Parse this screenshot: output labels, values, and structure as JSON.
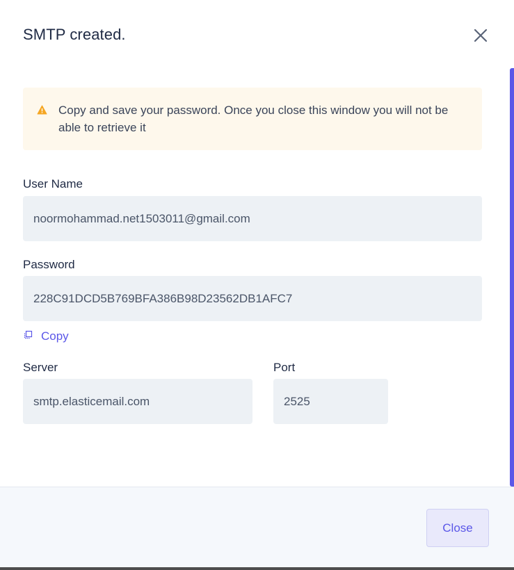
{
  "modal": {
    "title": "SMTP created."
  },
  "warning": {
    "message": "Copy and save your password. Once you close this window you will not be able to retrieve it"
  },
  "fields": {
    "username": {
      "label": "User Name",
      "value": "noormohammad.net1503011@gmail.com"
    },
    "password": {
      "label": "Password",
      "value": "228C91DCD5B769BFA386B98D23562DB1AFC7"
    },
    "server": {
      "label": "Server",
      "value": "smtp.elasticemail.com"
    },
    "port": {
      "label": "Port",
      "value": "2525"
    }
  },
  "copy": {
    "label": "Copy"
  },
  "footer": {
    "close_label": "Close"
  },
  "colors": {
    "accent": "#5b57e8",
    "warning_bg": "#fef8ec",
    "warning_icon": "#f5a623",
    "input_bg": "#edf1f5",
    "footer_bg": "#f5f8fc"
  },
  "icons": {
    "close": "close-icon",
    "warning": "warning-icon",
    "copy": "copy-icon"
  }
}
